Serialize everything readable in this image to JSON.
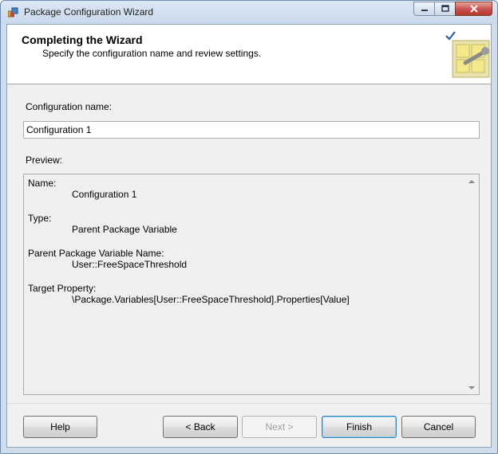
{
  "window": {
    "title": "Package Configuration Wizard"
  },
  "header": {
    "title": "Completing the Wizard",
    "subtitle": "Specify the configuration name and review settings."
  },
  "config_name": {
    "label": "Configuration name:",
    "value": "Configuration 1"
  },
  "preview": {
    "label": "Preview:",
    "items": [
      {
        "label": "Name:",
        "value": "Configuration 1"
      },
      {
        "label": "Type:",
        "value": "Parent Package Variable"
      },
      {
        "label": "Parent Package Variable Name:",
        "value": "User::FreeSpaceThreshold"
      },
      {
        "label": "Target Property:",
        "value": "\\Package.Variables[User::FreeSpaceThreshold].Properties[Value]"
      }
    ]
  },
  "buttons": {
    "help": "Help",
    "back": "< Back",
    "next": "Next >",
    "finish": "Finish",
    "cancel": "Cancel"
  }
}
